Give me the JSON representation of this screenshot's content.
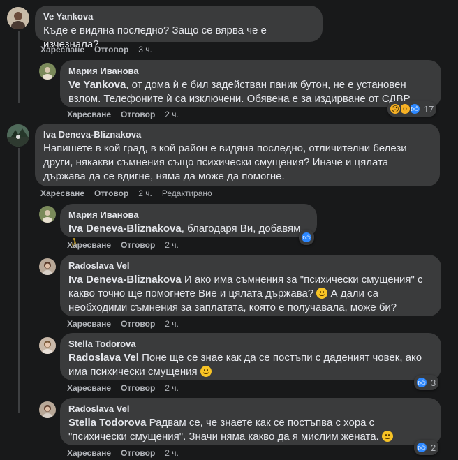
{
  "labels": {
    "like": "Харесване",
    "reply": "Отговор",
    "edited": "Редактирано"
  },
  "comments": [
    {
      "author": "Ve Yankova",
      "text": "Къде е видяна последно? Защо се вярва че е изчезнала?",
      "time": "3 ч."
    },
    {
      "author": "Мария Иванова",
      "mention": "Ve Yankova",
      "text": ", от дома ѝ е бил задействан паник бутон, не е установен взлом. Телефоните ѝ са изключени. Обявена е за издирване от СДВР.",
      "time": "2 ч.",
      "reaction_count": "17"
    },
    {
      "author": "Iva Deneva-Bliznakova",
      "text": "Напишете в кой град, в кой район е видяна последно, отличителни белези други, някакви съмнения също психически смущения? Иначе и цялата държава да се вдигне, няма да може да помогне.",
      "time": "2 ч."
    },
    {
      "author": "Мария Иванова",
      "mention": "Iva Deneva-Bliznakova",
      "text": ", благодаря Ви, добавям.",
      "time": "2 ч."
    },
    {
      "author": "Radoslava Vel",
      "mention": "Iva Deneva-Bliznakova",
      "text": " И ако има съмнения за \"психически смущения\" с какво точно ще помогнете Вие и цялата държава?",
      "text2": " А дали са необходими съмнения за заплатата, която е получавала, може би?",
      "time": "2 ч."
    },
    {
      "author": "Stella Todorova",
      "mention": "Radoslava Vel",
      "text": " Поне ще се знае как да се постъпи с даденият човек, ако има психически смущения",
      "time": "2 ч.",
      "reaction_count": "3"
    },
    {
      "author": "Radoslava Vel",
      "mention": "Stella Todorova",
      "text": " Радвам се, че знаете как се постъпва с хора с \"психически смущения\". Значи няма какво да я мислим жената.",
      "time": "2 ч.",
      "reaction_count": "2"
    }
  ],
  "icons": {
    "like": "like-icon",
    "sad": "sad-face-icon",
    "wow": "wow-face-icon",
    "pray": "pray-icon",
    "smile": "smile-emoji-icon",
    "wink": "wink-emoji-icon"
  },
  "colors": {
    "background": "#18191a",
    "bubble": "#3a3b3c",
    "text": "#e4e6eb",
    "meta": "#b0b3b8",
    "like_blue": "#2d88ff",
    "emoji_yellow": "#f7c325"
  }
}
